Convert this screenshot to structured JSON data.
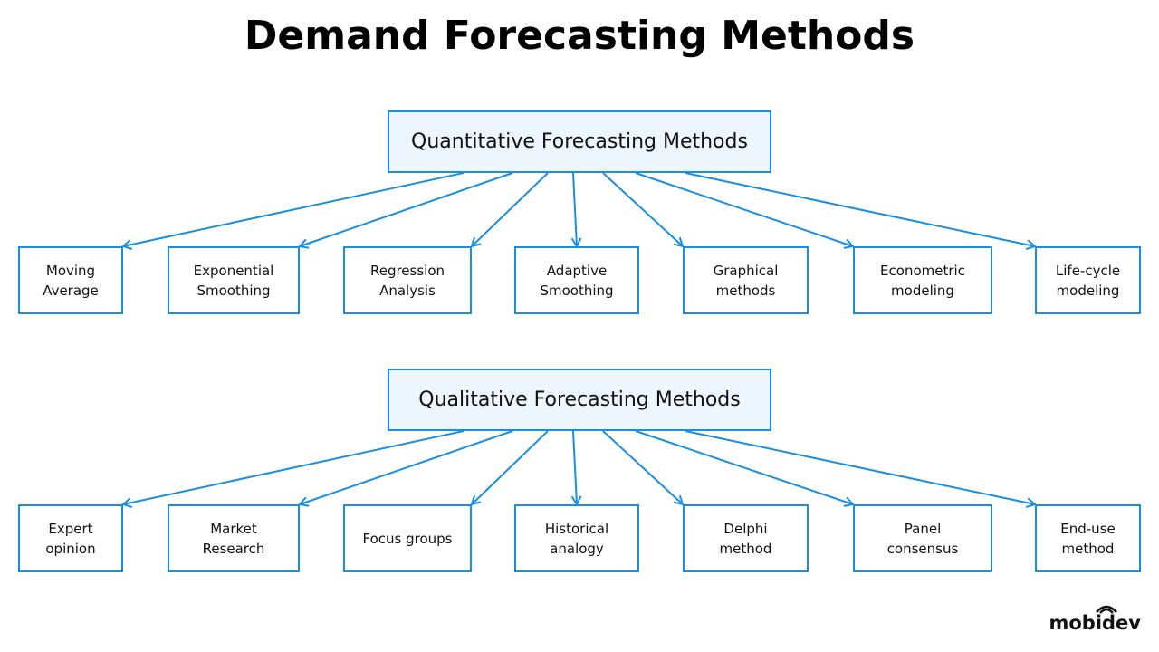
{
  "title": "Demand Forecasting Methods",
  "groups": [
    {
      "root": "Quantitative Forecasting Methods",
      "children": [
        "Moving\nAverage",
        "Exponential\nSmoothing",
        "Regression\nAnalysis",
        "Adaptive\nSmoothing",
        "Graphical\nmethods",
        "Econometric\nmodeling",
        "Life-cycle\nmodeling"
      ]
    },
    {
      "root": "Qualitative Forecasting Methods",
      "children": [
        "Expert\nopinion",
        "Market\nResearch",
        "Focus groups",
        "Historical\nanalogy",
        "Delphi\nmethod",
        "Panel\nconsensus",
        "End-use\nmethod"
      ]
    }
  ],
  "logo": "mobidev",
  "colors": {
    "accent": "#1a8fe0",
    "root_fill": "#eef6fd"
  }
}
